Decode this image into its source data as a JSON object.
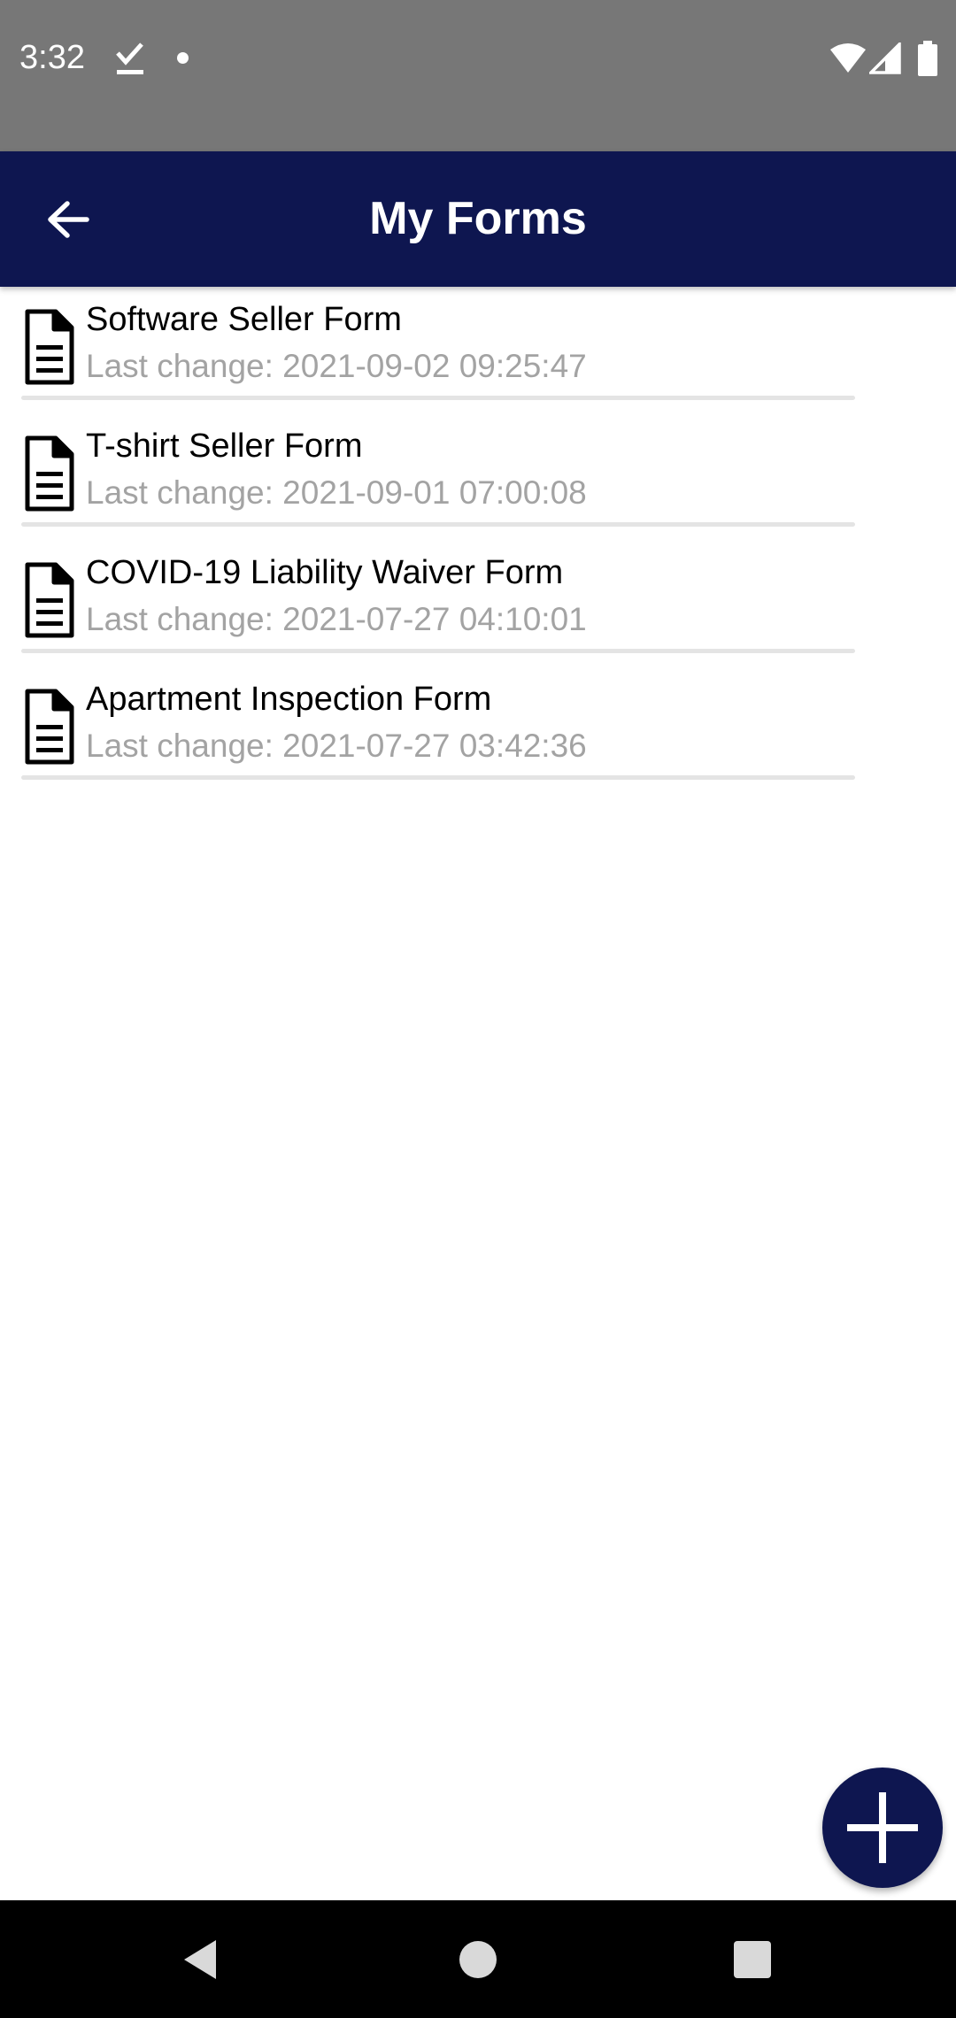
{
  "status_bar": {
    "time": "3:32",
    "icons": [
      "download-done-icon",
      "notification-dot-icon",
      "wifi-icon",
      "signal-icon",
      "battery-icon"
    ]
  },
  "app_bar": {
    "title": "My Forms",
    "back_icon": "arrow-back-icon",
    "background_color": "#0e1650"
  },
  "forms": [
    {
      "title": "Software Seller Form",
      "subtitle": "Last change: 2021-09-02 09:25:47",
      "icon": "document-icon"
    },
    {
      "title": "T-shirt Seller Form",
      "subtitle": "Last change: 2021-09-01 07:00:08",
      "icon": "document-icon"
    },
    {
      "title": "COVID-19 Liability Waiver Form",
      "subtitle": "Last change: 2021-07-27 04:10:01",
      "icon": "document-icon"
    },
    {
      "title": "Apartment Inspection Form",
      "subtitle": "Last change: 2021-07-27 03:42:36",
      "icon": "document-icon"
    }
  ],
  "fab": {
    "icon": "plus-icon",
    "color": "#0e1650"
  },
  "nav_bar": {
    "icons": [
      "nav-back-icon",
      "nav-home-icon",
      "nav-recents-icon"
    ]
  }
}
